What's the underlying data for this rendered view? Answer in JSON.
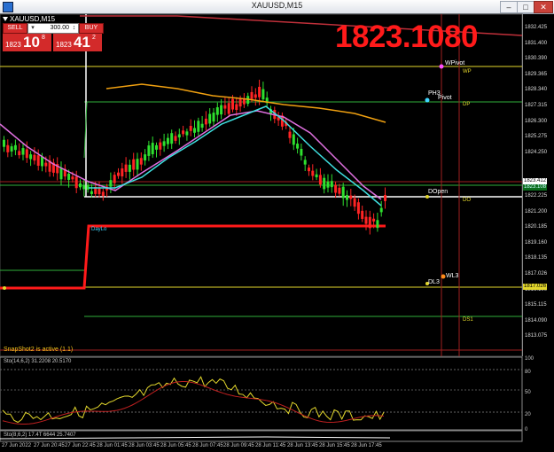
{
  "window": {
    "title": "XAUUSD,M15",
    "min_glyph": "–",
    "max_glyph": "□",
    "close_glyph": "✕"
  },
  "chart_header": {
    "symbol": "XAUUSD,M15"
  },
  "trade_panel": {
    "sell_label": "SELL",
    "buy_label": "BUY",
    "lot": "300.00",
    "bid_small": "1823",
    "bid_big": "10",
    "bid_sup": "8",
    "ask_small": "1823",
    "ask_big": "41",
    "ask_sup": "2",
    "color": "#d32a2a"
  },
  "big_price": {
    "text": "1823.1080",
    "color": "#ff1a1a"
  },
  "price_axis": [
    "1832.425",
    "1831.400",
    "1830.390",
    "1829.365",
    "1828.340",
    "1827.315",
    "1826.300",
    "1825.275",
    "1824.250",
    "1823.412",
    "1823.108",
    "1822.225",
    "1821.200",
    "1820.185",
    "1819.160",
    "1818.135",
    "1817.026",
    "1816.100",
    "1815.115",
    "1814.090",
    "1813.075"
  ],
  "price_tags": {
    "t1": "1823.412",
    "t2": "1823.108",
    "t3": "1817.026"
  },
  "levels": {
    "wpivot": "WPivot",
    "wp": "WP",
    "pivot": "Pivot",
    "ph3": "PH3",
    "dp": "DP",
    "dopen": "DOpen",
    "do": "DO",
    "daylo": "DayLo",
    "wl3": "WL3",
    "dl3": "DL3",
    "ds1": "DS1"
  },
  "snapshot": "SnapShot2 is active (1.1)",
  "osc1": {
    "title": "Sto(14,6,2) 31.2208 20.5170",
    "levels": [
      "100",
      "80",
      "50",
      "20",
      "0"
    ]
  },
  "osc2": {
    "title": "Sto(8,6,2) 17.4T 6644 25.7407"
  },
  "time_axis": [
    "27 Jun 2022",
    "27 Jun 20:45",
    "27 Jun 22:45",
    "28 Jun 01:45",
    "28 Jun 03:45",
    "28 Jun 05:45",
    "28 Jun 07:45",
    "28 Jun 09:45",
    "28 Jun 11:45",
    "28 Jun 13:45",
    "28 Jun 15:45",
    "28 Jun 17:45"
  ]
}
